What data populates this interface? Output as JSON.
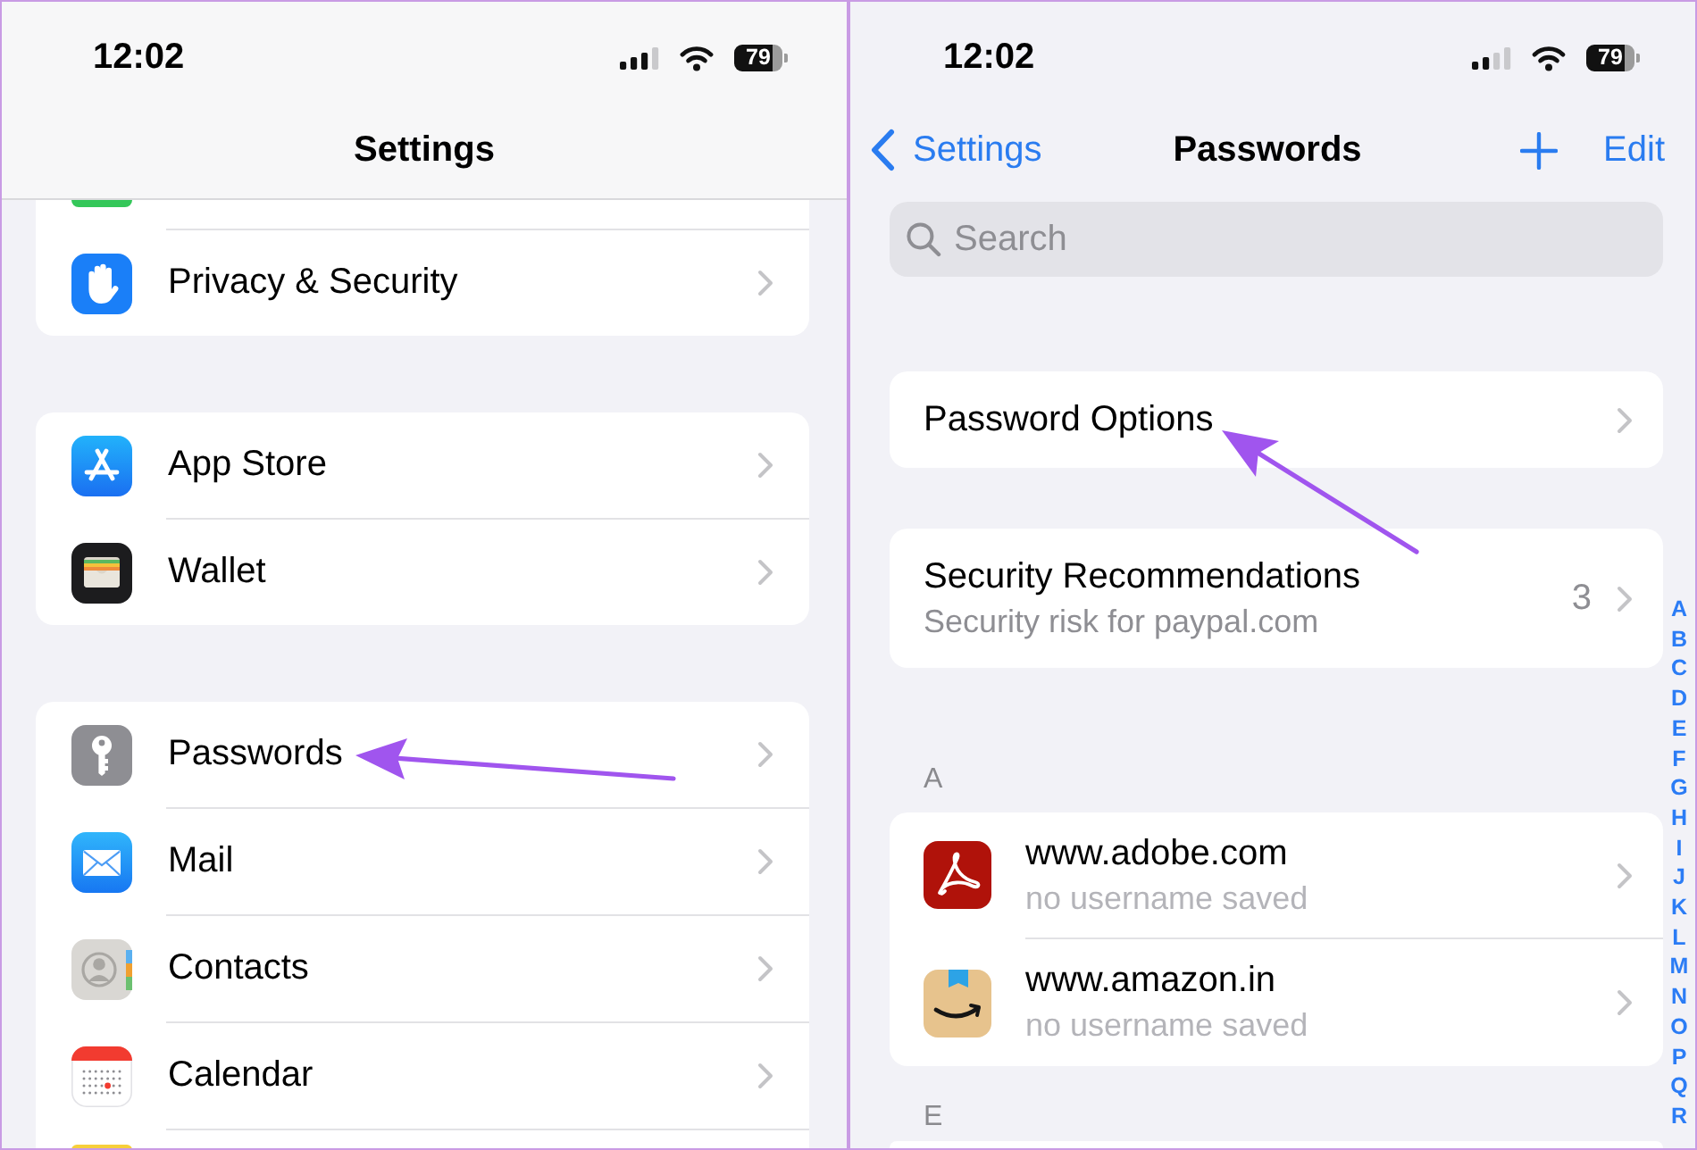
{
  "left": {
    "status_bar": {
      "time": "12:02",
      "battery": "79"
    },
    "title": "Settings",
    "groups": [
      {
        "rows": [
          {
            "label": "Privacy & Security",
            "pointed": false
          }
        ]
      },
      {
        "rows": [
          {
            "label": "App Store",
            "pointed": false
          },
          {
            "label": "Wallet",
            "pointed": false
          }
        ]
      },
      {
        "rows": [
          {
            "label": "Passwords",
            "pointed": true
          },
          {
            "label": "Mail",
            "pointed": false
          },
          {
            "label": "Contacts",
            "pointed": false
          },
          {
            "label": "Calendar",
            "pointed": false
          }
        ]
      }
    ]
  },
  "right": {
    "status_bar": {
      "time": "12:02",
      "battery": "79"
    },
    "back_button": "Settings",
    "title": "Passwords",
    "edit_button": "Edit",
    "search": {
      "placeholder": "Search"
    },
    "cards": [
      {
        "kind": "option",
        "label": "Password Options",
        "pointed": true
      },
      {
        "kind": "security",
        "title": "Security Recommendations",
        "subtitle": "Security risk for paypal.com",
        "count": "3",
        "pointed": false
      }
    ],
    "sections": [
      {
        "letter": "A",
        "entries": [
          {
            "site": "www.adobe.com",
            "username": "no username saved"
          },
          {
            "site": "www.amazon.in",
            "username": "no username saved"
          }
        ]
      },
      {
        "letter": "E"
      }
    ],
    "index": [
      "A",
      "B",
      "C",
      "D",
      "E",
      "F",
      "G",
      "H",
      "I",
      "J",
      "K",
      "L",
      "M",
      "N",
      "O",
      "P",
      "Q",
      "R"
    ]
  }
}
